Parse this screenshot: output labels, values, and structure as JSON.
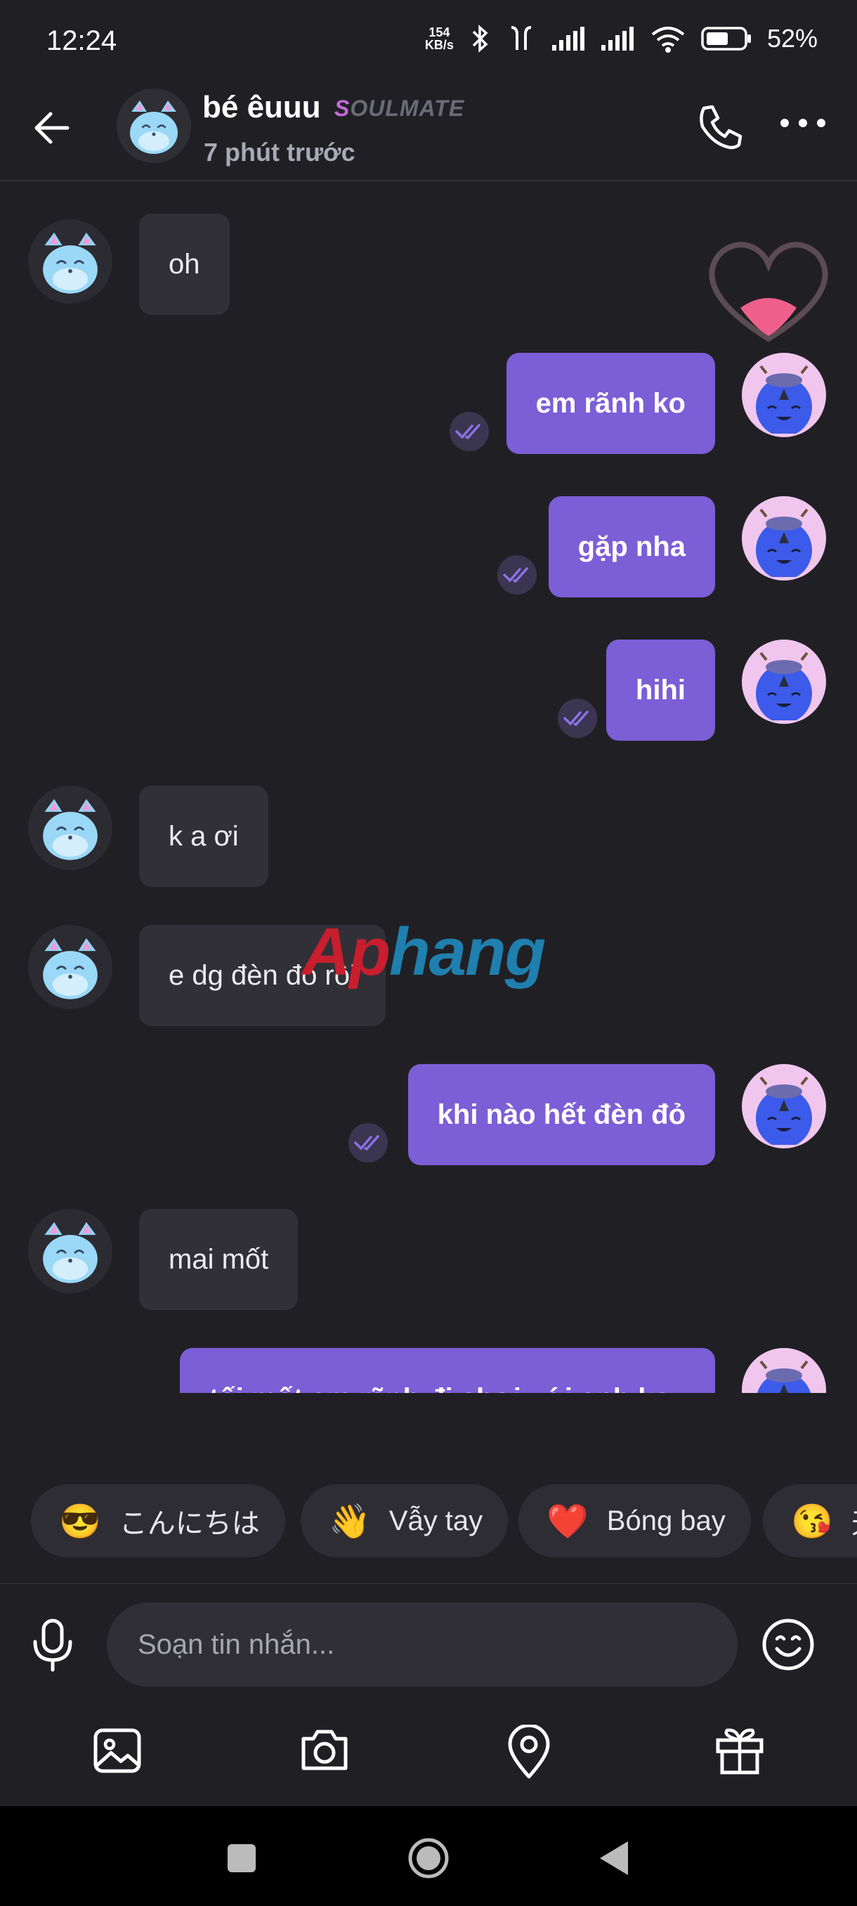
{
  "status_bar": {
    "time": "12:24",
    "net_speed_value": "154",
    "net_speed_unit": "KB/s",
    "battery": "52%"
  },
  "header": {
    "contact_name": "bé êuuu",
    "badge": "OULMATE",
    "badge_first": "S",
    "last_seen": "7 phút trước"
  },
  "messages": [
    {
      "from": "them",
      "text": "oh"
    },
    {
      "from": "me",
      "text": "em rãnh ko",
      "status": "read"
    },
    {
      "from": "me",
      "text": "gặp nha",
      "status": "read"
    },
    {
      "from": "me",
      "text": "hihi",
      "status": "read"
    },
    {
      "from": "them",
      "text": "k a ơi"
    },
    {
      "from": "them",
      "text": "e dg đèn đỏ rồi"
    },
    {
      "from": "me",
      "text": "khi nào hết đèn đỏ",
      "status": "read"
    },
    {
      "from": "them",
      "text": "mai mốt"
    },
    {
      "from": "me",
      "text": "tối mốt em rãnh đi chơi với anh ko",
      "status": "sending"
    }
  ],
  "watermark": {
    "part1": "Ap",
    "part2": "hang"
  },
  "quick_replies": [
    {
      "icon": "sun-sunglasses-emoji",
      "emoji": "😎",
      "label": "こんにちは"
    },
    {
      "icon": "waving-hand-emoji",
      "emoji": "👋",
      "label": "Vẫy tay"
    },
    {
      "icon": "red-heart-emoji",
      "emoji": "❤️",
      "label": "Bóng bay"
    },
    {
      "icon": "wink-kiss-emoji",
      "emoji": "😘",
      "label": "天"
    }
  ],
  "composer": {
    "placeholder": "Soạn tin nhắn..."
  },
  "colors": {
    "background": "#202024",
    "my_bubble": "#7c5ed6",
    "their_bubble": "#303036"
  }
}
